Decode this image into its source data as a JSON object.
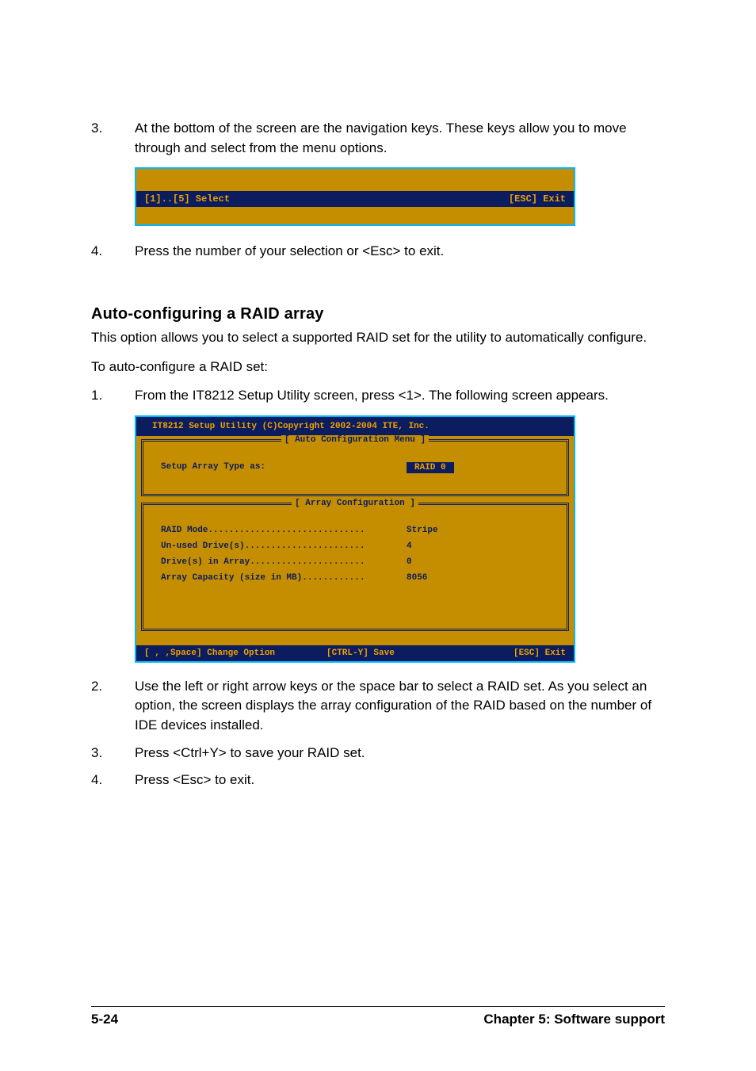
{
  "list1": {
    "item3_num": "3.",
    "item3_text": "At the bottom of the screen are the navigation keys. These keys allow you to move through and select from the menu options.",
    "item4_num": "4.",
    "item4_text": "Press the number of your selection or <Esc> to exit."
  },
  "termbar": {
    "left": "[1]..[5] Select",
    "right": "[ESC] Exit"
  },
  "heading": "Auto-configuring a RAID array",
  "para1": "This option allows you to select a supported RAID set for the utility to automatically configure.",
  "para2": "To auto-configure a RAID set:",
  "list2": {
    "item1_num": "1.",
    "item1_text": "From the IT8212 Setup Utility screen, press <1>. The following screen appears.",
    "item2_num": "2.",
    "item2_text": "Use the left or right arrow keys or the space bar to select a RAID set. As you select an option, the screen displays the array configuration of the RAID based on the number of IDE devices installed.",
    "item3_num": "3.",
    "item3_text": "Press <Ctrl+Y> to save your RAID set.",
    "item4_num": "4.",
    "item4_text": "Press <Esc> to exit."
  },
  "utility": {
    "title": "IT8212 Setup Utility (C)Copyright 2002-2004 ITE, Inc.",
    "panel1_legend": "[ Auto Configuration Menu ]",
    "panel1_label": "Setup Array Type as:",
    "panel1_value": "RAID 0",
    "panel2_legend": "[ Array Configuration ]",
    "rows": [
      {
        "label": "RAID Mode..............................",
        "value": "Stripe"
      },
      {
        "label": "Un-used Drive(s).......................",
        "value": "4"
      },
      {
        "label": "Drive(s) in Array......................",
        "value": "0"
      },
      {
        "label": "Array Capacity (size in MB)............",
        "value": "8056"
      }
    ],
    "footer": {
      "f1": "[ , ,Space] Change Option",
      "f2": "[CTRL-Y] Save",
      "f3": "[ESC] Exit"
    }
  },
  "footer": {
    "page": "5-24",
    "chapter": "Chapter 5: Software support"
  }
}
